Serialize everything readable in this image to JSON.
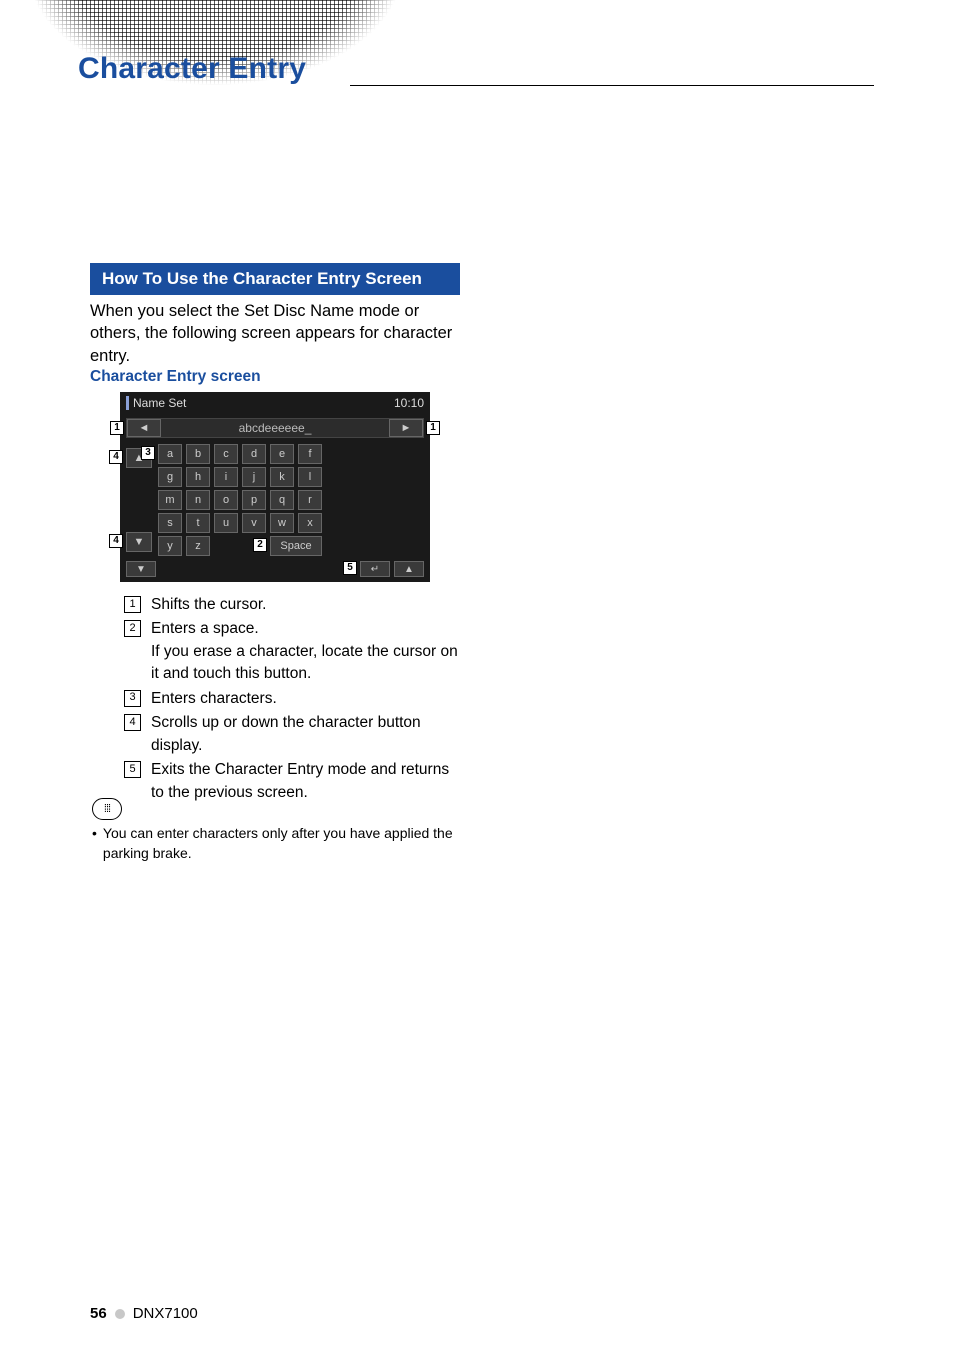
{
  "title": "Character Entry",
  "section_heading": "How To Use the Character Entry Screen",
  "intro_text": "When you select the Set Disc Name mode or others, the following screen appears for character entry.",
  "subheading": "Character Entry screen",
  "device": {
    "header_title": "Name Set",
    "clock": "10:10",
    "entered_text": "abcdeeeeee_",
    "nav_left_glyph": "◄",
    "nav_right_glyph": "►",
    "scroll_up_glyph": "▲",
    "scroll_down_glyph": "▼",
    "keys_row1": [
      "a",
      "b",
      "c",
      "d",
      "e",
      "f"
    ],
    "keys_row2": [
      "g",
      "h",
      "i",
      "j",
      "k",
      "l"
    ],
    "keys_row3": [
      "m",
      "n",
      "o",
      "p",
      "q",
      "r"
    ],
    "keys_row4": [
      "s",
      "t",
      "u",
      "v",
      "w",
      "x"
    ],
    "keys_row5_left": [
      "y",
      "z"
    ],
    "space_label": "Space",
    "footer_left_glyph": "▼",
    "footer_right_return_glyph": "↵",
    "footer_right_end_glyph": "▲"
  },
  "callouts": {
    "c1": "1",
    "c2": "2",
    "c3": "3",
    "c4": "4",
    "c5": "5"
  },
  "list": [
    {
      "n": "1",
      "text": "Shifts the cursor."
    },
    {
      "n": "2",
      "text": "Enters a space.\nIf you erase a character, locate the cursor on it and touch this button."
    },
    {
      "n": "3",
      "text": "Enters characters."
    },
    {
      "n": "4",
      "text": "Scrolls up or down the character button display."
    },
    {
      "n": "5",
      "text": "Exits the Character Entry mode and returns to the previous screen."
    }
  ],
  "note_bullet": "•",
  "note_text": "You can enter characters only after you have applied the parking brake.",
  "footer": {
    "page_number": "56",
    "model": "DNX7100"
  }
}
